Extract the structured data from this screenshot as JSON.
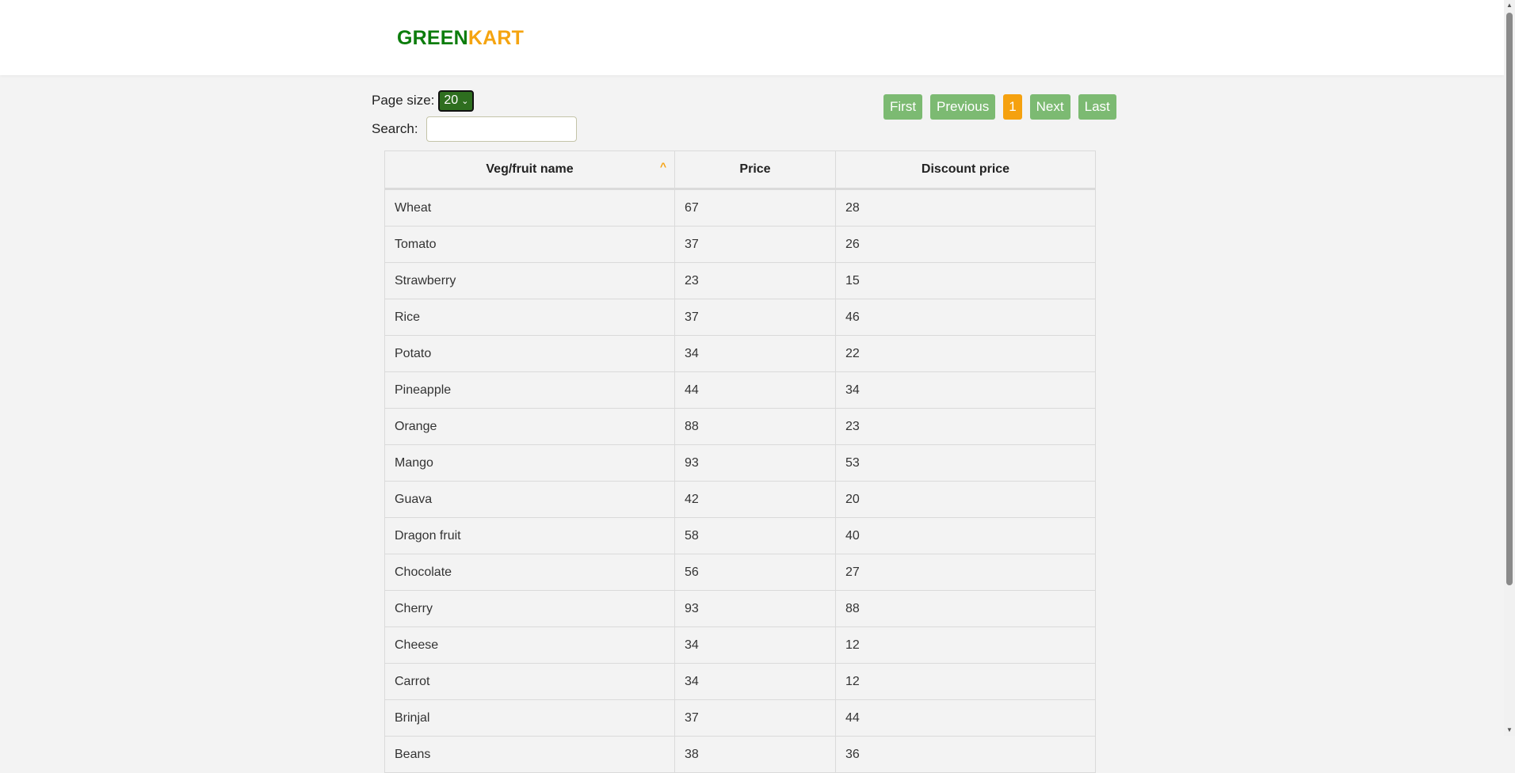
{
  "brand": {
    "part1": "GREEN",
    "part2": "KART",
    "color1": "#0c7d0c",
    "color2": "#f5a410"
  },
  "controls": {
    "page_size_label": "Page size:",
    "page_size_value": "20",
    "search_label": "Search:",
    "search_value": "",
    "search_placeholder": ""
  },
  "pager": {
    "first": "First",
    "previous": "Previous",
    "current": "1",
    "next": "Next",
    "last": "Last"
  },
  "table": {
    "columns": [
      "Veg/fruit name",
      "Price",
      "Discount price"
    ],
    "sort_icon": "chevron-up-icon",
    "rows": [
      [
        "Wheat",
        "67",
        "28"
      ],
      [
        "Tomato",
        "37",
        "26"
      ],
      [
        "Strawberry",
        "23",
        "15"
      ],
      [
        "Rice",
        "37",
        "46"
      ],
      [
        "Potato",
        "34",
        "22"
      ],
      [
        "Pineapple",
        "44",
        "34"
      ],
      [
        "Orange",
        "88",
        "23"
      ],
      [
        "Mango",
        "93",
        "53"
      ],
      [
        "Guava",
        "42",
        "20"
      ],
      [
        "Dragon fruit",
        "58",
        "40"
      ],
      [
        "Chocolate",
        "56",
        "27"
      ],
      [
        "Cherry",
        "93",
        "88"
      ],
      [
        "Cheese",
        "34",
        "12"
      ],
      [
        "Carrot",
        "34",
        "12"
      ],
      [
        "Brinjal",
        "37",
        "44"
      ],
      [
        "Beans",
        "38",
        "36"
      ]
    ]
  },
  "colors": {
    "accent": "#f5a10f",
    "pager_button": "#7cba72",
    "select_bg": "#2e6e1f"
  }
}
